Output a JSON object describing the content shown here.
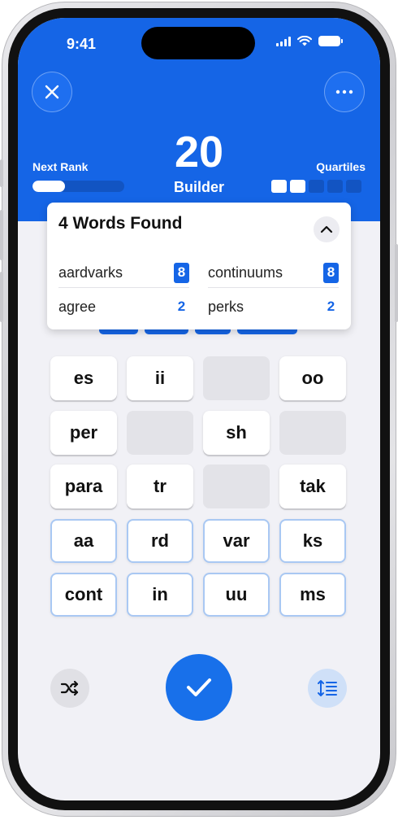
{
  "status_bar": {
    "time": "9:41"
  },
  "header": {
    "score": "20",
    "rank": "Builder",
    "next_rank_label": "Next Rank",
    "next_rank_progress": 0.35,
    "quartiles_label": "Quartiles",
    "quartiles_total": 5,
    "quartiles_found": 2,
    "close_icon": "close-icon",
    "more_icon": "more-icon"
  },
  "words_found": {
    "title": "4 Words Found",
    "collapse_icon": "chevron-up-icon",
    "words": [
      {
        "word": "aardvarks",
        "points": "8",
        "quartile": true
      },
      {
        "word": "continuums",
        "points": "8",
        "quartile": true
      },
      {
        "word": "agree",
        "points": "2",
        "quartile": false
      },
      {
        "word": "perks",
        "points": "2",
        "quartile": false
      }
    ]
  },
  "tiles": [
    {
      "label": "es",
      "state": "normal"
    },
    {
      "label": "ii",
      "state": "normal"
    },
    {
      "label": "",
      "state": "used"
    },
    {
      "label": "oo",
      "state": "normal"
    },
    {
      "label": "per",
      "state": "normal"
    },
    {
      "label": "",
      "state": "used"
    },
    {
      "label": "sh",
      "state": "normal"
    },
    {
      "label": "",
      "state": "used"
    },
    {
      "label": "para",
      "state": "normal"
    },
    {
      "label": "tr",
      "state": "normal"
    },
    {
      "label": "",
      "state": "used"
    },
    {
      "label": "tak",
      "state": "normal"
    },
    {
      "label": "aa",
      "state": "selected"
    },
    {
      "label": "rd",
      "state": "selected"
    },
    {
      "label": "var",
      "state": "selected"
    },
    {
      "label": "ks",
      "state": "selected"
    },
    {
      "label": "cont",
      "state": "selected"
    },
    {
      "label": "in",
      "state": "selected"
    },
    {
      "label": "uu",
      "state": "selected"
    },
    {
      "label": "ms",
      "state": "selected"
    }
  ],
  "controls": {
    "shuffle_icon": "shuffle-icon",
    "submit_icon": "checkmark-icon",
    "sort_icon": "sort-list-icon"
  },
  "colors": {
    "accent": "#1565e6",
    "tile_selected_border": "#a9c8f3",
    "tile_used": "#e3e3e8",
    "background": "#f1f1f6"
  }
}
